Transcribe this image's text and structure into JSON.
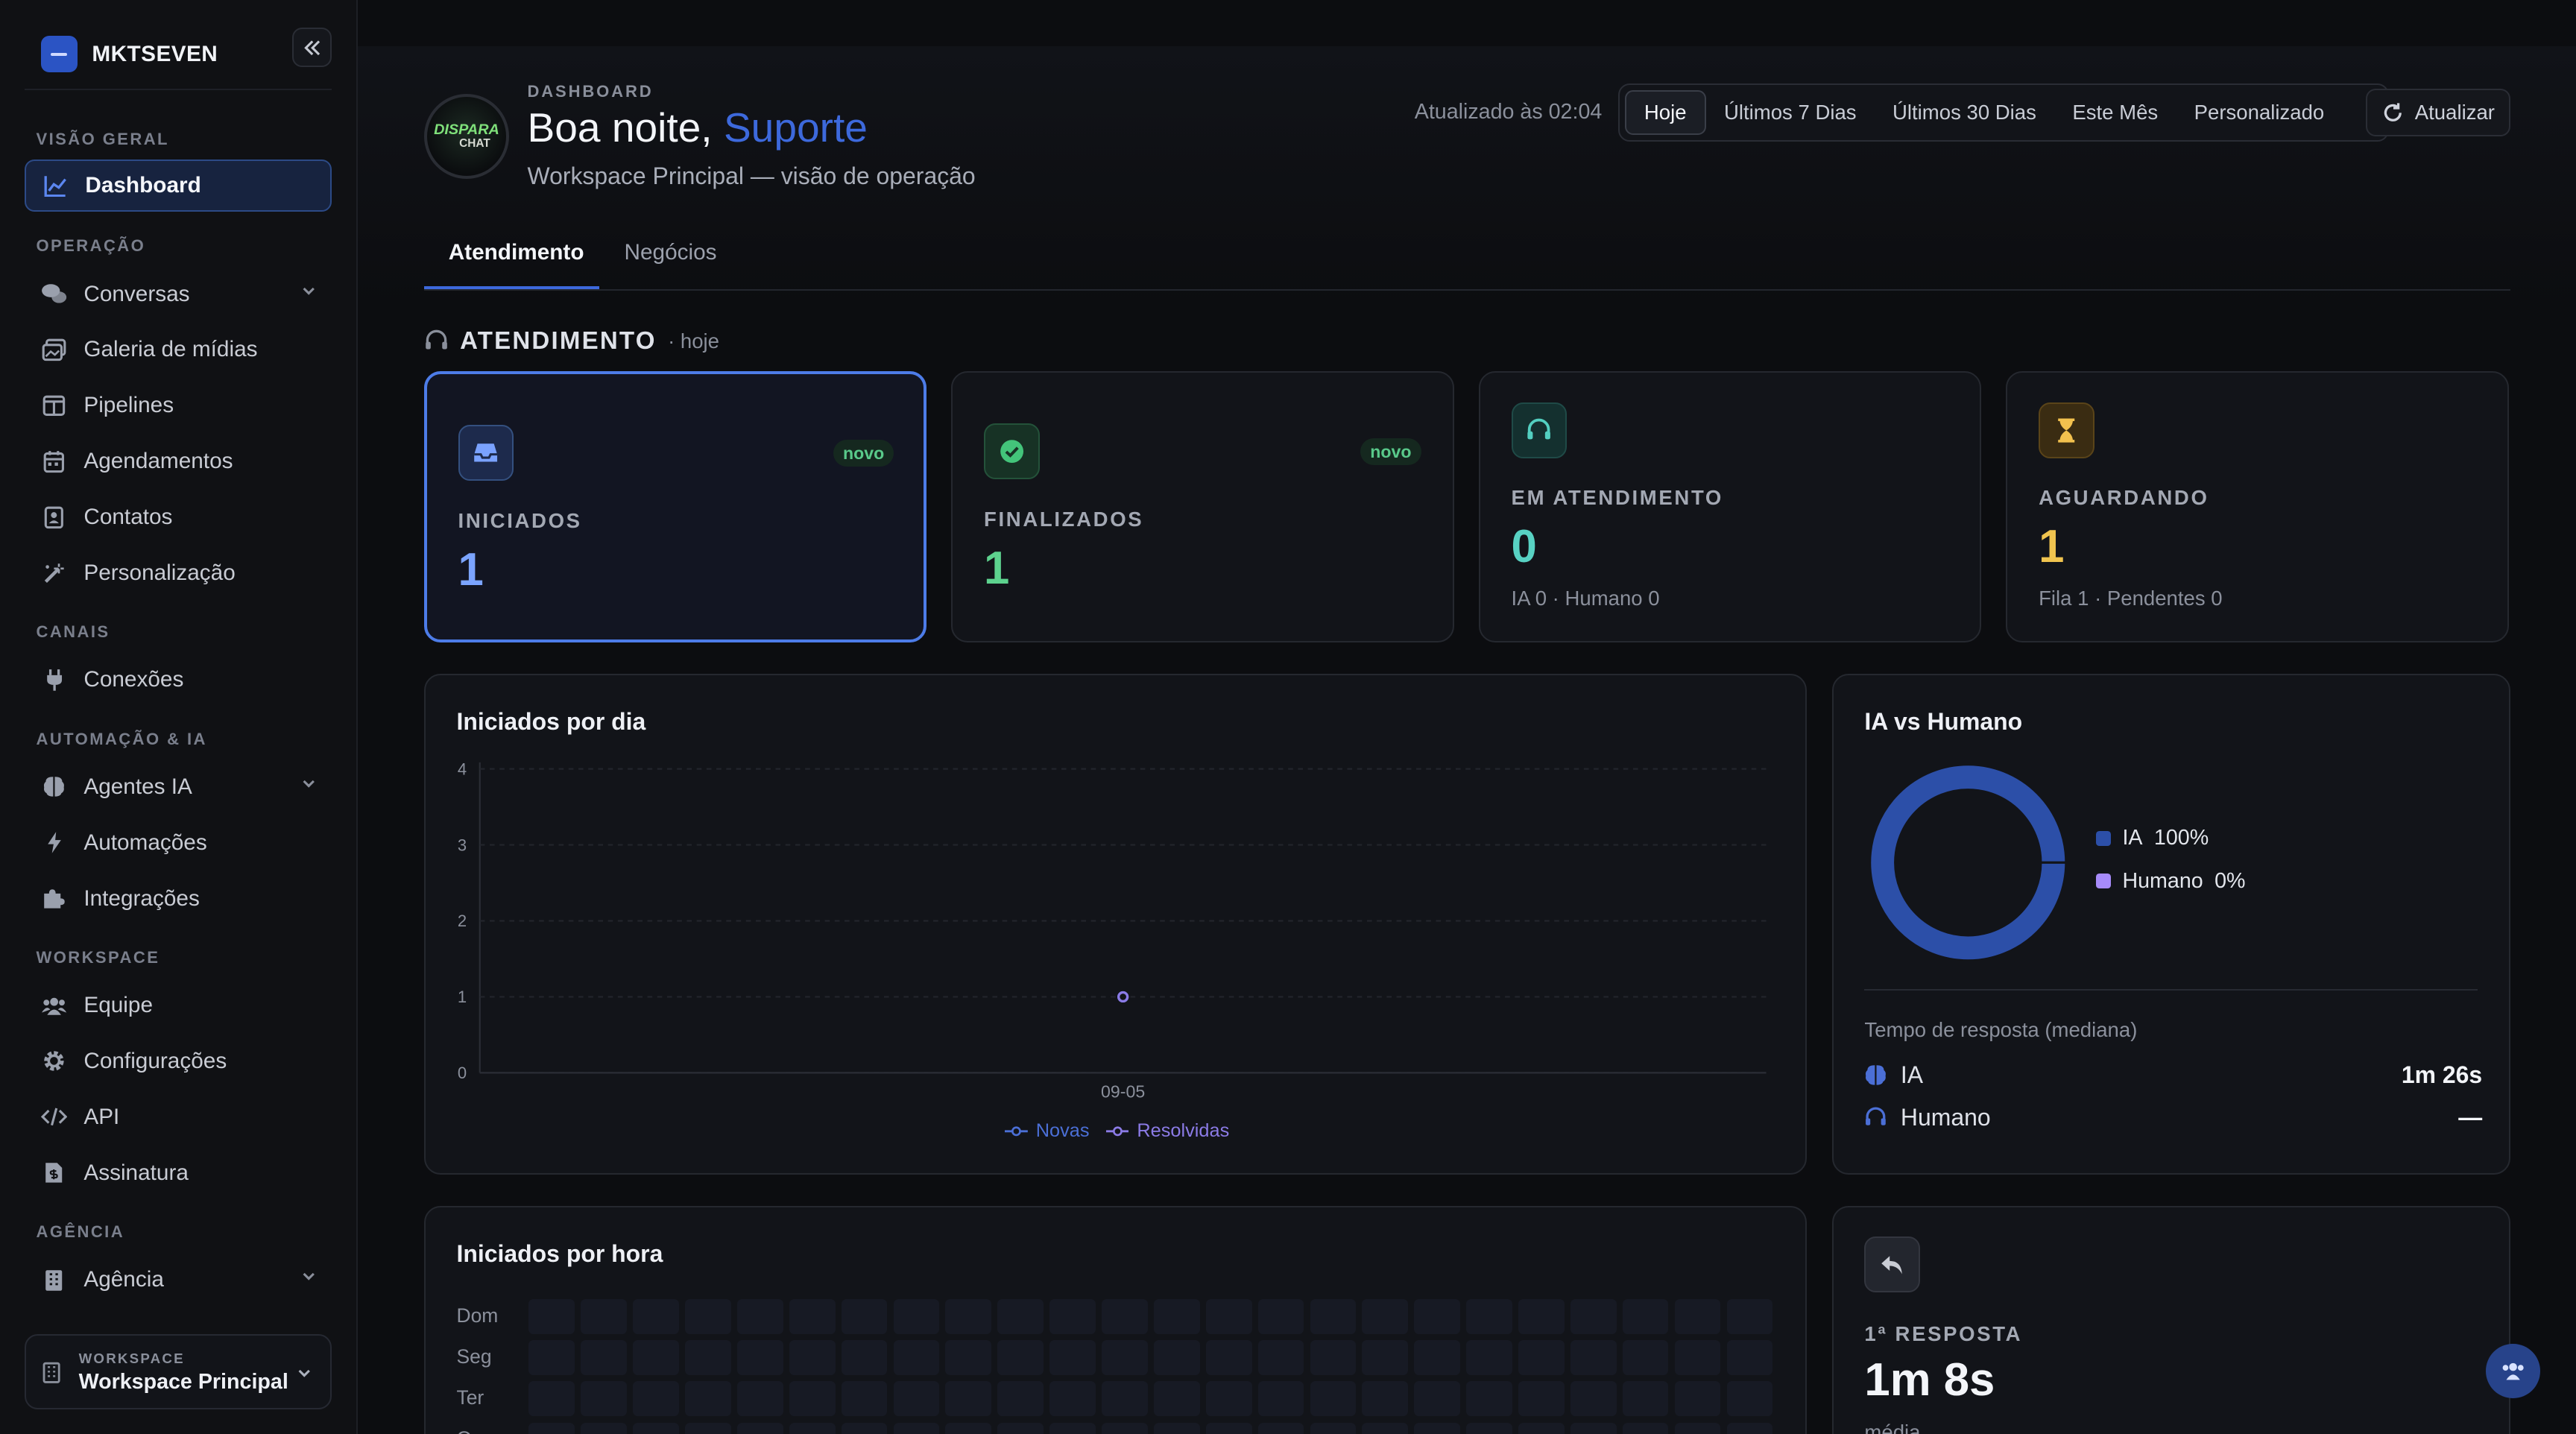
{
  "brand": {
    "name": "MKTSEVEN"
  },
  "sidebar": {
    "groups": {
      "visao": "VISÃO GERAL",
      "operacao": "OPERAÇÃO",
      "canais": "CANAIS",
      "automacao": "AUTOMAÇÃO & IA",
      "workspace": "WORKSPACE",
      "agencia": "AGÊNCIA"
    },
    "items": {
      "dashboard": "Dashboard",
      "conversas": "Conversas",
      "galeria": "Galeria de mídias",
      "pipelines": "Pipelines",
      "agendamentos": "Agendamentos",
      "contatos": "Contatos",
      "personalizacao": "Personalização",
      "conexoes": "Conexões",
      "agentes": "Agentes IA",
      "automacoes": "Automações",
      "integracoes": "Integrações",
      "equipe": "Equipe",
      "configuracoes": "Configurações",
      "api": "API",
      "assinatura": "Assinatura",
      "agencia": "Agência"
    },
    "workspace_switcher": {
      "label": "WORKSPACE",
      "name": "Workspace Principal"
    }
  },
  "header": {
    "avatar_text_1": "DISPARA",
    "avatar_text_2": "CHAT",
    "eyebrow": "DASHBOARD",
    "greeting": "Boa noite,",
    "user_name": "Suporte",
    "subtitle": "Workspace Principal — visão de operação",
    "updated": "Atualizado às 02:04",
    "ranges": [
      "Hoje",
      "Últimos 7 Dias",
      "Últimos 30 Dias",
      "Este Mês",
      "Personalizado"
    ],
    "selected_range": "Hoje",
    "refresh_label": "Atualizar"
  },
  "tabs": {
    "atendimento": "Atendimento",
    "negocios": "Negócios"
  },
  "section": {
    "title": "ATENDIMENTO",
    "subtitle": "· hoje"
  },
  "kpis": {
    "iniciados": {
      "label": "INICIADOS",
      "value": "1",
      "badge": "novo"
    },
    "finalizados": {
      "label": "FINALIZADOS",
      "value": "1",
      "badge": "novo"
    },
    "em_atendimento": {
      "label": "EM ATENDIMENTO",
      "value": "0",
      "meta": "IA 0 · Humano 0"
    },
    "aguardando": {
      "label": "AGUARDANDO",
      "value": "1",
      "meta": "Fila 1 · Pendentes 0"
    }
  },
  "colors": {
    "accent": "#3d69dc",
    "novas": "#4b6fd6",
    "resolvidas": "#8b7be6",
    "ia": "#2c4fa8",
    "humano": "#a78bfa"
  },
  "chart_day": {
    "title": "Iniciados por dia"
  },
  "chart_data": [
    {
      "type": "line",
      "title": "Iniciados por dia",
      "x": [
        "09-05"
      ],
      "yticks": [
        "0",
        "1",
        "2",
        "3",
        "4"
      ],
      "ylim": [
        0,
        4
      ],
      "series": [
        {
          "name": "Novas",
          "values": [
            1
          ]
        },
        {
          "name": "Resolvidas",
          "values": [
            1
          ]
        }
      ],
      "grid": true,
      "legend": "bottom-center"
    },
    {
      "type": "pie",
      "title": "IA vs Humano",
      "categories": [
        "IA",
        "Humano"
      ],
      "values": [
        100,
        0
      ],
      "labels": [
        "100%",
        "0%"
      ],
      "legend": "right"
    }
  ],
  "donut": {
    "title": "IA vs Humano",
    "ia_label": "IA",
    "ia_pct": "100%",
    "humano_label": "Humano",
    "humano_pct": "0%"
  },
  "response_time": {
    "label": "Tempo de resposta (mediana)",
    "ia_label": "IA",
    "ia_value": "1m 26s",
    "humano_label": "Humano",
    "humano_value": "—"
  },
  "chart_hour": {
    "title": "Iniciados por hora",
    "days": [
      "Dom",
      "Seg",
      "Ter",
      "Qua"
    ]
  },
  "first_response": {
    "label": "1ª RESPOSTA",
    "value": "1m 8s",
    "meta": "média"
  }
}
